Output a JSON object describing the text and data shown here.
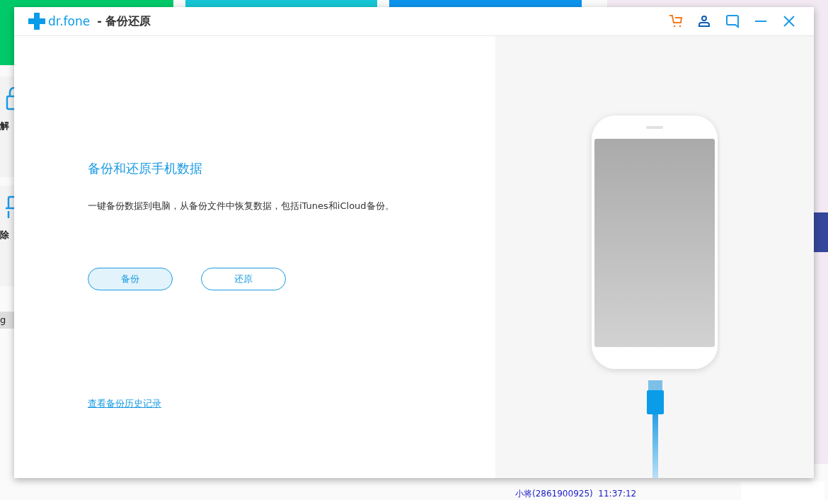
{
  "background": {
    "side_cards": [
      {
        "title": "解",
        "kind": "lock"
      },
      {
        "title": "除",
        "kind": "brush"
      }
    ],
    "fragment": "g",
    "chat_line": "小将(2861900925)  11:37:12"
  },
  "window": {
    "logo": "dr.fone",
    "title": "- 备份还原"
  },
  "content": {
    "heading": "备份和还原手机数据",
    "description": "一键备份数据到电脑，从备份文件中恢复数据，包括iTunes和iCloud备份。",
    "buttons": [
      {
        "label": "备份",
        "selected": true
      },
      {
        "label": "还原",
        "selected": false
      }
    ],
    "history_link": "查看备份历史记录"
  }
}
